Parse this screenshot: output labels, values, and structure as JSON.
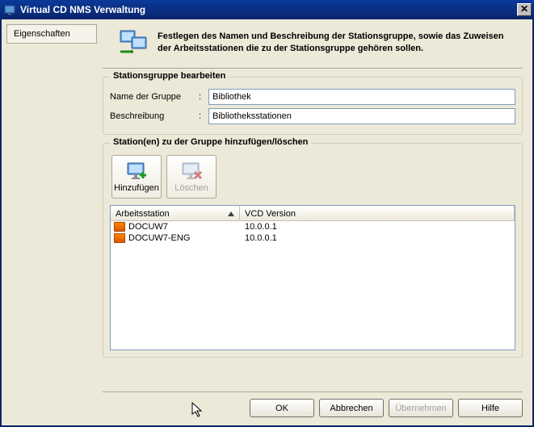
{
  "window": {
    "title": "Virtual CD NMS Verwaltung"
  },
  "sidebar": {
    "tab_label": "Eigenschaften"
  },
  "header": {
    "text": "Festlegen des Namen und Beschreibung der Stationsgruppe, sowie das Zuweisen der Arbeitsstationen die zu der Stationsgruppe gehören sollen."
  },
  "edit_group": {
    "box_title": "Stationsgruppe bearbeiten",
    "name_label": "Name der Gruppe",
    "name_value": "Bibliothek",
    "desc_label": "Beschreibung",
    "desc_value": "Bibliotheksstationen"
  },
  "stations_box_title": "Station(en) zu der Gruppe hinzufügen/löschen",
  "toolbar": {
    "add_label": "Hinzufügen",
    "delete_label": "Löschen"
  },
  "list": {
    "col_station": "Arbeitsstation",
    "col_version": "VCD Version",
    "rows": [
      {
        "name": "DOCUW7",
        "version": "10.0.0.1"
      },
      {
        "name": "DOCUW7-ENG",
        "version": "10.0.0.1"
      }
    ]
  },
  "buttons": {
    "ok": "OK",
    "cancel": "Abbrechen",
    "apply": "Übernehmen",
    "help": "Hilfe"
  }
}
